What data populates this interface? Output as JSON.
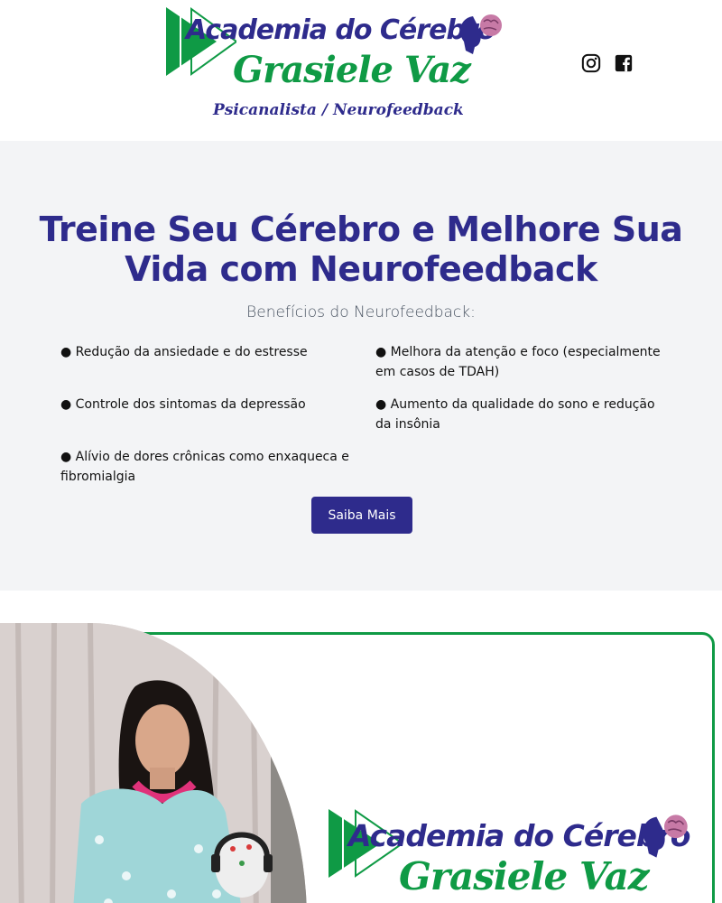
{
  "header": {
    "logo": {
      "brand": "Academia do Cérebro",
      "name": "Grasiele Vaz",
      "tagline": "Psicanalista / Neurofeedback"
    },
    "social": [
      {
        "icon": "instagram-icon"
      },
      {
        "icon": "facebook-icon"
      }
    ]
  },
  "hero": {
    "title": "Treine Seu Cérebro e Melhore Sua Vida com Neurofeedback",
    "subtitle": "Benefícios do Neurofeedback:",
    "benefits": [
      "● Redução da ansiedade e do estresse",
      "● Melhora da atenção e foco (especialmente em casos de TDAH)",
      "● Controle dos sintomas da depressão",
      "● Aumento da qualidade do sono e redução da insônia",
      "● Alívio de dores crônicas como enxaqueca e fibromialgia"
    ],
    "button": "Saiba Mais"
  },
  "about": {
    "logo": {
      "brand": "Academia do Cérebro",
      "name": "Grasiele Vaz"
    }
  },
  "colors": {
    "brand_blue": "#2e2b8c",
    "brand_green": "#0f9a45",
    "hero_bg": "#f3f4f6"
  }
}
